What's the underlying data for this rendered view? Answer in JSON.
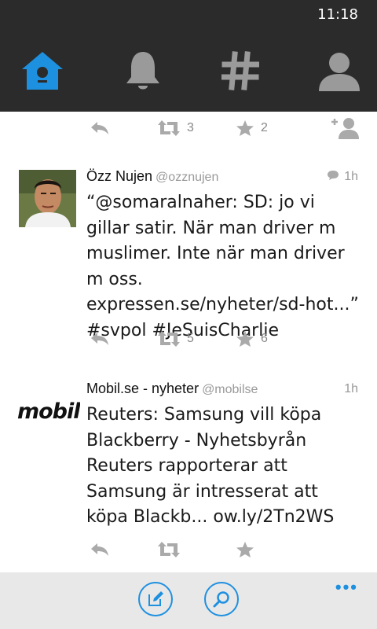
{
  "status": {
    "time": "11:18"
  },
  "nav": {
    "items": [
      {
        "name": "home",
        "active": true
      },
      {
        "name": "notifications",
        "active": false
      },
      {
        "name": "discover",
        "active": false
      },
      {
        "name": "profile",
        "active": false
      }
    ],
    "active_color": "#1e90e0",
    "inactive_color": "#9a9a9a"
  },
  "feed": {
    "partial_tweet": {
      "retweets": "3",
      "favorites": "2"
    },
    "tweets": [
      {
        "name": "Özz Nujen",
        "handle": "@ozznujen",
        "time": "1h",
        "has_reply_icon": true,
        "text": "“@somaralnaher: SD: jo vi gillar satir. När man driver m muslimer. Inte när man driver m oss. expressen.se/nyheter/sd-hot...” #svpol #JeSuisCharlie",
        "retweets": "5",
        "favorites": "6"
      },
      {
        "name": "Mobil.se - nyheter",
        "handle": "@mobilse",
        "time": "1h",
        "avatar_text": "mobil",
        "text": "Reuters: Samsung vill köpa Blackberry - Nyhetsbyrån Reuters rapporterar att Samsung är intresserat att köpa Blackb... ow.ly/2Tn2WS",
        "retweets": "",
        "favorites": ""
      }
    ]
  },
  "appbar": {
    "more": "•••"
  }
}
